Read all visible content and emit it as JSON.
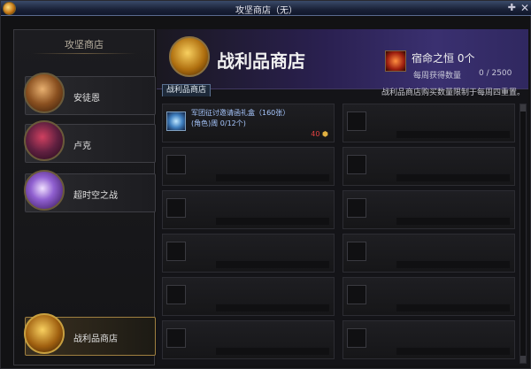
{
  "window": {
    "title": "攻坚商店（无）"
  },
  "sidebar": {
    "header": "攻坚商店",
    "npcs": [
      {
        "label": "安徒恩"
      },
      {
        "label": "卢克"
      },
      {
        "label": "超时空之战"
      },
      {
        "label": "战利品商店"
      }
    ]
  },
  "banner": {
    "shop_title": "战利品商店",
    "currency_name": "宿命之恒 0个",
    "weekly_label": "每周获得数量",
    "weekly_value": "0 / 2500",
    "note": "战利品商店购买数量限制于每周四重置。"
  },
  "tab": {
    "label": "战利品商店"
  },
  "items": [
    {
      "name": "军团征讨邀请函礼盒（160张）",
      "limit": "(角色)周 0/12个)",
      "price": "40"
    }
  ]
}
